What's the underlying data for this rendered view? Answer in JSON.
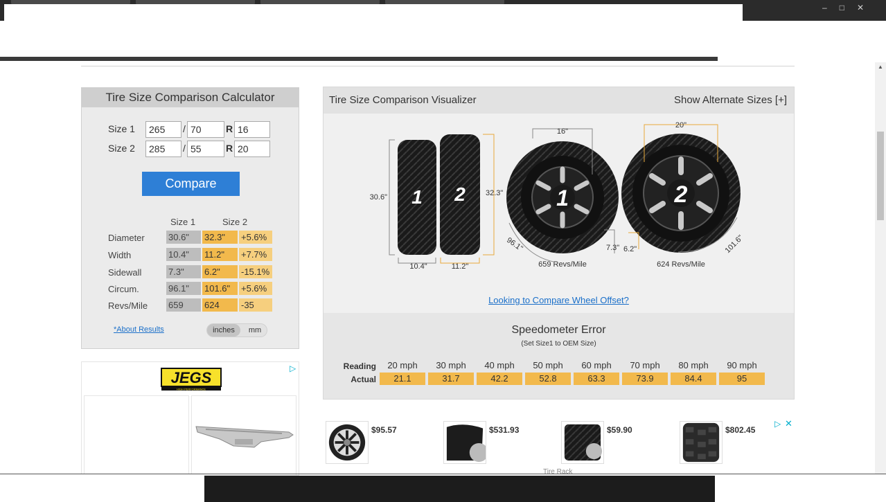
{
  "calculator": {
    "title": "Tire Size Comparison Calculator",
    "size1": {
      "label": "Size 1",
      "width": "265",
      "aspect": "70",
      "rim": "16"
    },
    "size2": {
      "label": "Size 2",
      "width": "285",
      "aspect": "55",
      "rim": "20"
    },
    "slash": "/",
    "r": "R",
    "compare_label": "Compare",
    "col_size1": "Size 1",
    "col_size2": "Size 2",
    "rows": [
      {
        "label": "Diameter",
        "s1": "30.6\"",
        "s2": "32.3\"",
        "diff": "+5.6%"
      },
      {
        "label": "Width",
        "s1": "10.4\"",
        "s2": "11.2\"",
        "diff": "+7.7%"
      },
      {
        "label": "Sidewall",
        "s1": "7.3\"",
        "s2": "6.2\"",
        "diff": "-15.1%"
      },
      {
        "label": "Circum.",
        "s1": "96.1\"",
        "s2": "101.6\"",
        "diff": "+5.6%"
      },
      {
        "label": "Revs/Mile",
        "s1": "659",
        "s2": "624",
        "diff": "-35"
      }
    ],
    "about_link": "*About Results",
    "unit_inches": "inches",
    "unit_mm": "mm"
  },
  "ad_left": {
    "logo_text": "JEGS",
    "logo_tagline": "HIGH PERFORMANCE"
  },
  "visualizer": {
    "title": "Tire Size Comparison Visualizer",
    "alt_sizes": "Show Alternate Sizes [+]",
    "tire1_num": "1",
    "tire2_num": "2",
    "tire1_height": "30.6\"",
    "tire2_height": "32.3\"",
    "tire1_width": "10.4\"",
    "tire2_width": "11.2\"",
    "wheel1_rim": "16\"",
    "wheel2_rim": "20\"",
    "wheel1_circ": "96.1\"",
    "wheel2_circ": "101.6\"",
    "wheel1_sidewall": "7.3\"",
    "wheel2_sidewall": "6.2\"",
    "wheel1_revs": "659 Revs/Mile",
    "wheel2_revs": "624 Revs/Mile",
    "offset_link": "Looking to Compare Wheel Offset?"
  },
  "speedometer": {
    "title": "Speedometer Error",
    "subtitle": "(Set Size1 to OEM Size)",
    "reading_label": "Reading",
    "actual_label": "Actual",
    "readings": [
      "20 mph",
      "30 mph",
      "40 mph",
      "50 mph",
      "60 mph",
      "70 mph",
      "80 mph",
      "90 mph"
    ],
    "actuals": [
      "21.1",
      "31.7",
      "42.2",
      "52.8",
      "63.3",
      "73.9",
      "84.4",
      "95"
    ]
  },
  "products": [
    {
      "price": "$95.57",
      "icon": "wheel-icon"
    },
    {
      "price": "$531.93",
      "icon": "slick-tire-icon"
    },
    {
      "price": "$59.90",
      "icon": "tire-icon"
    },
    {
      "price": "$802.45",
      "icon": "offroad-tire-icon"
    }
  ],
  "ad_right": {
    "close": "✕",
    "source": "Tire Rack"
  },
  "colors": {
    "accent_blue": "#2e7fd6",
    "size2_orange": "#f2b94c",
    "size1_gray": "#bdbdbd"
  }
}
